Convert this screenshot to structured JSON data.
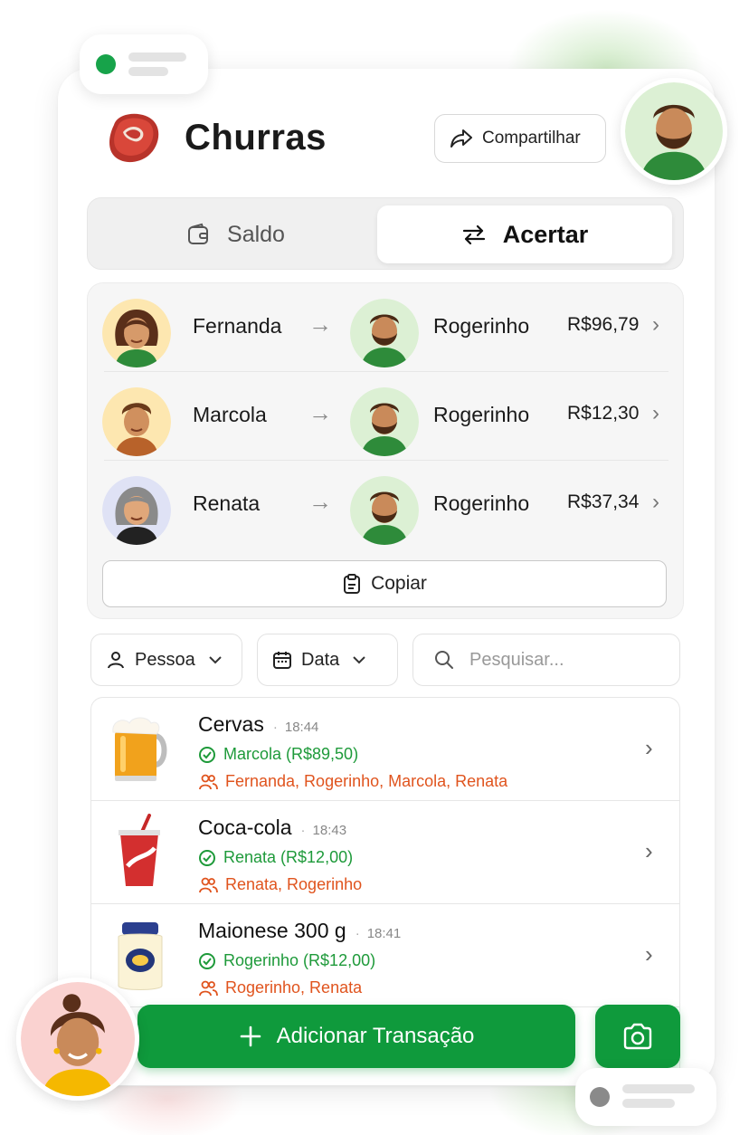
{
  "app": {
    "title": "Churras",
    "share_label": "Compartilhar",
    "accent_color": "#0f9a3c"
  },
  "tabs": {
    "saldo_label": "Saldo",
    "acertar_label": "Acertar",
    "active": "Acertar"
  },
  "settlements": [
    {
      "from": "Fernanda",
      "to": "Rogerinho",
      "amount": "R$96,79"
    },
    {
      "from": "Marcola",
      "to": "Rogerinho",
      "amount": "R$12,30"
    },
    {
      "from": "Renata",
      "to": "Rogerinho",
      "amount": "R$37,34"
    }
  ],
  "copy_label": "Copiar",
  "filters": {
    "person_label": "Pessoa",
    "date_label": "Data",
    "search_placeholder": "Pesquisar..."
  },
  "transactions": [
    {
      "name": "Cervas",
      "time": "18:44",
      "payer": "Marcola (R$89,50)",
      "participants": "Fernanda, Rogerinho, Marcola, Renata",
      "icon": "beer-mug"
    },
    {
      "name": "Coca-cola",
      "time": "18:43",
      "payer": "Renata (R$12,00)",
      "participants": "Renata, Rogerinho",
      "icon": "soda-cup"
    },
    {
      "name": "Maionese 300 g",
      "time": "18:41",
      "payer": "Rogerinho (R$12,00)",
      "participants": "Rogerinho, Renata",
      "icon": "mayonnaise-jar"
    }
  ],
  "add_transaction_label": "Adicionar Transação",
  "colors": {
    "payer_green": "#1e9a3a",
    "participants_orange": "#e0541e"
  }
}
